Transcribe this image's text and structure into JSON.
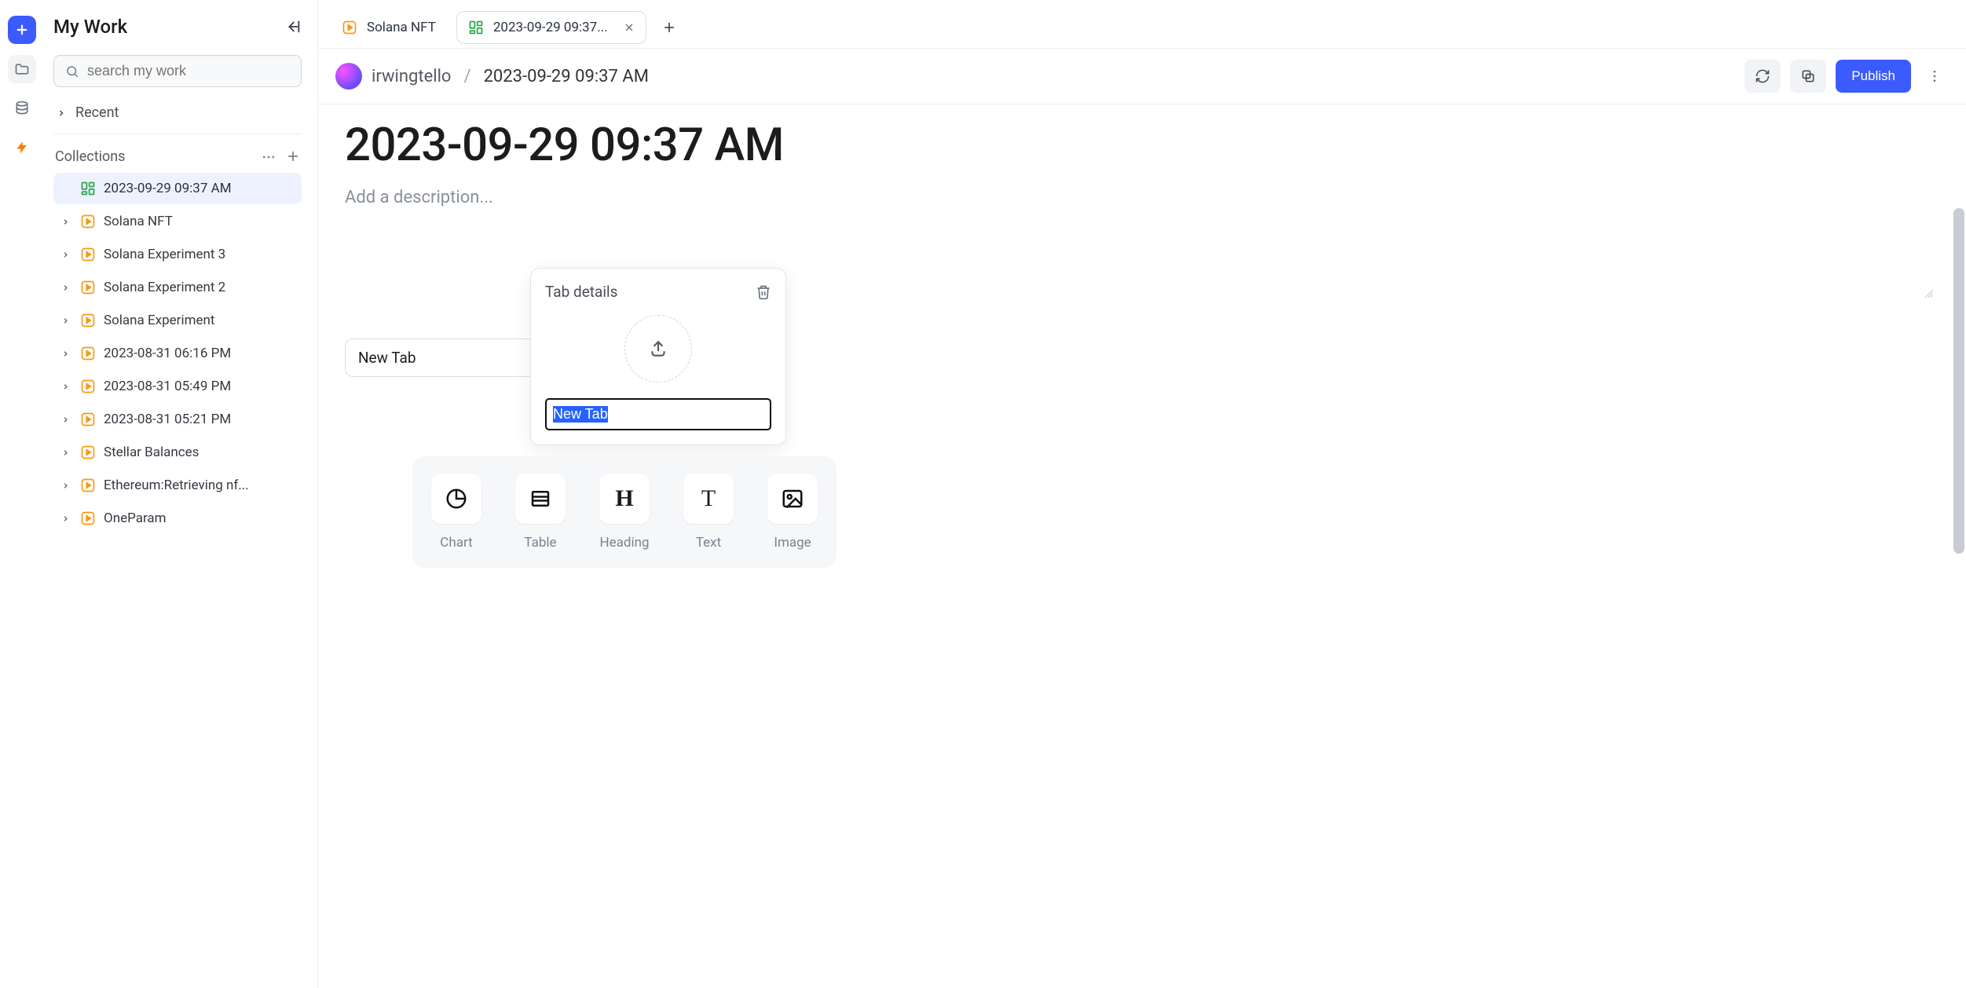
{
  "sidebar": {
    "title": "My Work",
    "search_placeholder": "search my work",
    "recent_label": "Recent",
    "collections_label": "Collections",
    "items": [
      {
        "label": "2023-09-29 09:37 AM",
        "kind": "dashboard",
        "active": true
      },
      {
        "label": "Solana NFT",
        "kind": "query"
      },
      {
        "label": "Solana Experiment 3",
        "kind": "query"
      },
      {
        "label": "Solana Experiment 2",
        "kind": "query"
      },
      {
        "label": "Solana Experiment",
        "kind": "query"
      },
      {
        "label": "2023-08-31 06:16 PM",
        "kind": "query"
      },
      {
        "label": "2023-08-31 05:49 PM",
        "kind": "query"
      },
      {
        "label": "2023-08-31 05:21 PM",
        "kind": "query"
      },
      {
        "label": "Stellar Balances",
        "kind": "query"
      },
      {
        "label": "Ethereum:Retrieving nf...",
        "kind": "query"
      },
      {
        "label": "OneParam",
        "kind": "query"
      }
    ]
  },
  "tabs": [
    {
      "label": "Solana NFT",
      "kind": "query",
      "active": false
    },
    {
      "label": "2023-09-29 09:37...",
      "kind": "dashboard",
      "active": true
    }
  ],
  "breadcrumb": {
    "user": "irwingtello",
    "title": "2023-09-29 09:37 AM"
  },
  "actions": {
    "publish_label": "Publish"
  },
  "page": {
    "title": "2023-09-29 09:37 AM",
    "description_placeholder": "Add a description..."
  },
  "new_tab_pill_label": "New Tab",
  "popover": {
    "title": "Tab details",
    "input_value": "New Tab"
  },
  "block_picker": {
    "items": [
      {
        "name": "chart",
        "label": "Chart"
      },
      {
        "name": "table",
        "label": "Table"
      },
      {
        "name": "heading",
        "label": "Heading"
      },
      {
        "name": "text",
        "label": "Text"
      },
      {
        "name": "image",
        "label": "Image"
      }
    ]
  }
}
